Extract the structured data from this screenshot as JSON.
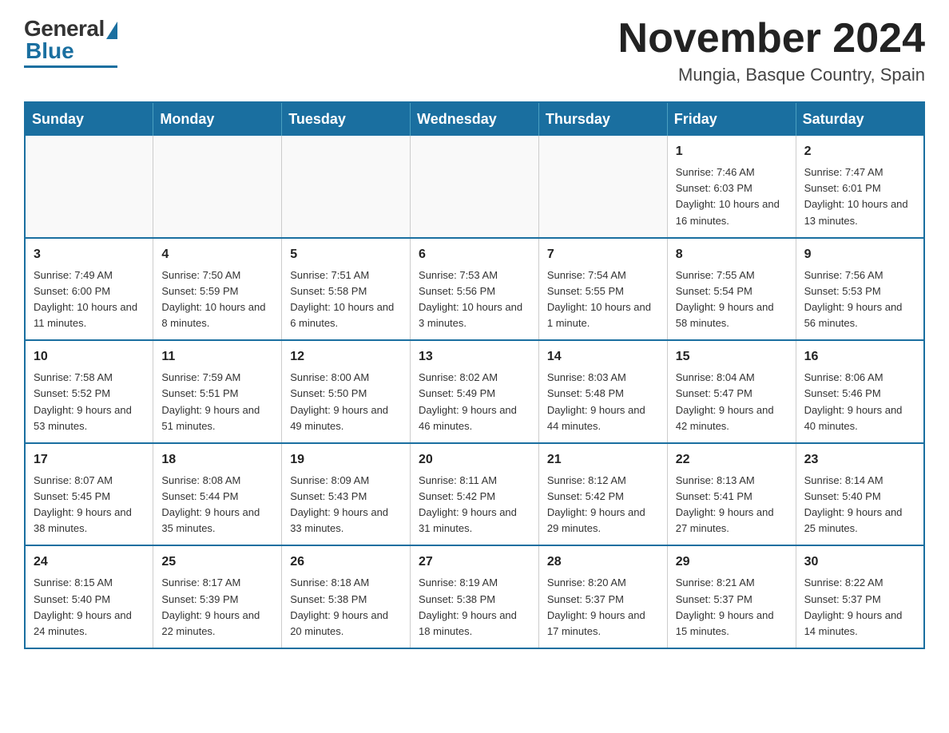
{
  "header": {
    "logo": {
      "general": "General",
      "blue": "Blue"
    },
    "title": "November 2024",
    "location": "Mungia, Basque Country, Spain"
  },
  "calendar": {
    "days_of_week": [
      "Sunday",
      "Monday",
      "Tuesday",
      "Wednesday",
      "Thursday",
      "Friday",
      "Saturday"
    ],
    "weeks": [
      [
        {
          "day": "",
          "info": ""
        },
        {
          "day": "",
          "info": ""
        },
        {
          "day": "",
          "info": ""
        },
        {
          "day": "",
          "info": ""
        },
        {
          "day": "",
          "info": ""
        },
        {
          "day": "1",
          "info": "Sunrise: 7:46 AM\nSunset: 6:03 PM\nDaylight: 10 hours and 16 minutes."
        },
        {
          "day": "2",
          "info": "Sunrise: 7:47 AM\nSunset: 6:01 PM\nDaylight: 10 hours and 13 minutes."
        }
      ],
      [
        {
          "day": "3",
          "info": "Sunrise: 7:49 AM\nSunset: 6:00 PM\nDaylight: 10 hours and 11 minutes."
        },
        {
          "day": "4",
          "info": "Sunrise: 7:50 AM\nSunset: 5:59 PM\nDaylight: 10 hours and 8 minutes."
        },
        {
          "day": "5",
          "info": "Sunrise: 7:51 AM\nSunset: 5:58 PM\nDaylight: 10 hours and 6 minutes."
        },
        {
          "day": "6",
          "info": "Sunrise: 7:53 AM\nSunset: 5:56 PM\nDaylight: 10 hours and 3 minutes."
        },
        {
          "day": "7",
          "info": "Sunrise: 7:54 AM\nSunset: 5:55 PM\nDaylight: 10 hours and 1 minute."
        },
        {
          "day": "8",
          "info": "Sunrise: 7:55 AM\nSunset: 5:54 PM\nDaylight: 9 hours and 58 minutes."
        },
        {
          "day": "9",
          "info": "Sunrise: 7:56 AM\nSunset: 5:53 PM\nDaylight: 9 hours and 56 minutes."
        }
      ],
      [
        {
          "day": "10",
          "info": "Sunrise: 7:58 AM\nSunset: 5:52 PM\nDaylight: 9 hours and 53 minutes."
        },
        {
          "day": "11",
          "info": "Sunrise: 7:59 AM\nSunset: 5:51 PM\nDaylight: 9 hours and 51 minutes."
        },
        {
          "day": "12",
          "info": "Sunrise: 8:00 AM\nSunset: 5:50 PM\nDaylight: 9 hours and 49 minutes."
        },
        {
          "day": "13",
          "info": "Sunrise: 8:02 AM\nSunset: 5:49 PM\nDaylight: 9 hours and 46 minutes."
        },
        {
          "day": "14",
          "info": "Sunrise: 8:03 AM\nSunset: 5:48 PM\nDaylight: 9 hours and 44 minutes."
        },
        {
          "day": "15",
          "info": "Sunrise: 8:04 AM\nSunset: 5:47 PM\nDaylight: 9 hours and 42 minutes."
        },
        {
          "day": "16",
          "info": "Sunrise: 8:06 AM\nSunset: 5:46 PM\nDaylight: 9 hours and 40 minutes."
        }
      ],
      [
        {
          "day": "17",
          "info": "Sunrise: 8:07 AM\nSunset: 5:45 PM\nDaylight: 9 hours and 38 minutes."
        },
        {
          "day": "18",
          "info": "Sunrise: 8:08 AM\nSunset: 5:44 PM\nDaylight: 9 hours and 35 minutes."
        },
        {
          "day": "19",
          "info": "Sunrise: 8:09 AM\nSunset: 5:43 PM\nDaylight: 9 hours and 33 minutes."
        },
        {
          "day": "20",
          "info": "Sunrise: 8:11 AM\nSunset: 5:42 PM\nDaylight: 9 hours and 31 minutes."
        },
        {
          "day": "21",
          "info": "Sunrise: 8:12 AM\nSunset: 5:42 PM\nDaylight: 9 hours and 29 minutes."
        },
        {
          "day": "22",
          "info": "Sunrise: 8:13 AM\nSunset: 5:41 PM\nDaylight: 9 hours and 27 minutes."
        },
        {
          "day": "23",
          "info": "Sunrise: 8:14 AM\nSunset: 5:40 PM\nDaylight: 9 hours and 25 minutes."
        }
      ],
      [
        {
          "day": "24",
          "info": "Sunrise: 8:15 AM\nSunset: 5:40 PM\nDaylight: 9 hours and 24 minutes."
        },
        {
          "day": "25",
          "info": "Sunrise: 8:17 AM\nSunset: 5:39 PM\nDaylight: 9 hours and 22 minutes."
        },
        {
          "day": "26",
          "info": "Sunrise: 8:18 AM\nSunset: 5:38 PM\nDaylight: 9 hours and 20 minutes."
        },
        {
          "day": "27",
          "info": "Sunrise: 8:19 AM\nSunset: 5:38 PM\nDaylight: 9 hours and 18 minutes."
        },
        {
          "day": "28",
          "info": "Sunrise: 8:20 AM\nSunset: 5:37 PM\nDaylight: 9 hours and 17 minutes."
        },
        {
          "day": "29",
          "info": "Sunrise: 8:21 AM\nSunset: 5:37 PM\nDaylight: 9 hours and 15 minutes."
        },
        {
          "day": "30",
          "info": "Sunrise: 8:22 AM\nSunset: 5:37 PM\nDaylight: 9 hours and 14 minutes."
        }
      ]
    ]
  }
}
